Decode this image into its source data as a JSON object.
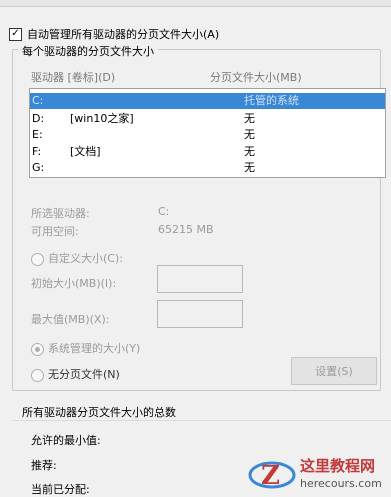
{
  "auto_manage": {
    "checked": true,
    "label": "自动管理所有驱动器的分页文件大小(A)"
  },
  "group_title": "每个驱动器的分页文件大小",
  "columns": {
    "drive": "驱动器 [卷标](D)",
    "size": "分页文件大小(MB)"
  },
  "drives": [
    {
      "drive": "C:",
      "label": "",
      "size": "托管的系统",
      "selected": true
    },
    {
      "drive": "D:",
      "label": "[win10之家]",
      "size": "无",
      "selected": false
    },
    {
      "drive": "E:",
      "label": "",
      "size": "无",
      "selected": false
    },
    {
      "drive": "F:",
      "label": "[文档]",
      "size": "无",
      "selected": false
    },
    {
      "drive": "G:",
      "label": "",
      "size": "无",
      "selected": false
    }
  ],
  "selected_drive": {
    "label": "所选驱动器:",
    "value": "C:"
  },
  "free_space": {
    "label": "可用空间:",
    "value": "65215 MB"
  },
  "custom_size": {
    "label": "自定义大小(C):",
    "initial_label": "初始大小(MB)(I):",
    "max_label": "最大值(MB)(X):"
  },
  "system_managed": {
    "label": "系统管理的大小(Y)"
  },
  "no_paging": {
    "label": "无分页文件(N)"
  },
  "set_button": "设置(S)",
  "totals": {
    "title": "所有驱动器分页文件大小的总数",
    "min_label": "允许的最小值:",
    "recommended_label": "推荐:",
    "current_label": "当前已分配:"
  },
  "watermark": {
    "title": "这里教程网",
    "url": "herecours.com",
    "logo_letter": "Z"
  },
  "colors": {
    "selection": "#3a87d6",
    "watermark": "#c23a3a",
    "disabled": "#9b9b9b"
  }
}
